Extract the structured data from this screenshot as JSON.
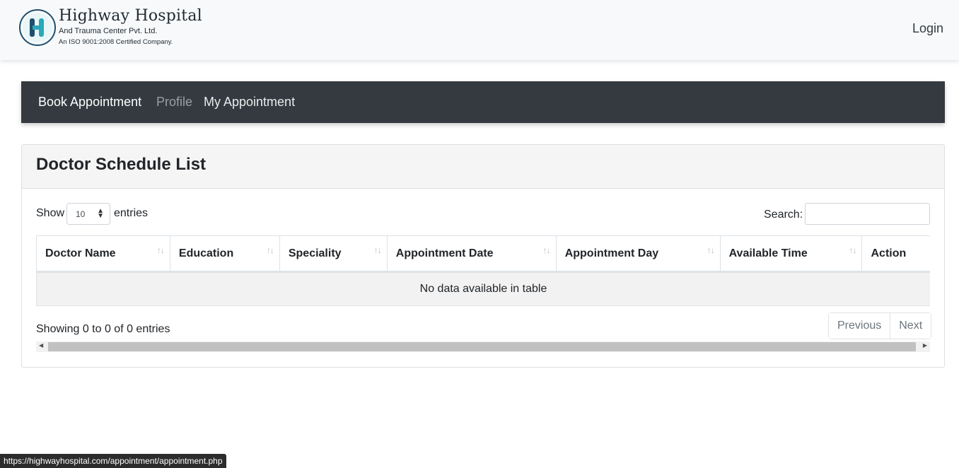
{
  "header": {
    "logo_title": "Highway Hospital",
    "logo_subtitle": "And Trauma Center Pvt. Ltd.",
    "logo_tagline": "An ISO 9001:2008 Certified Company.",
    "login_label": "Login",
    "colors": {
      "logo_teal": "#2aa8b8",
      "logo_dark": "#1f4f6b"
    }
  },
  "nav": {
    "items": [
      {
        "label": "Book Appointment",
        "state": "active"
      },
      {
        "label": "Profile",
        "state": "muted"
      },
      {
        "label": "My Appointment",
        "state": "normal"
      }
    ],
    "background": "#343a40"
  },
  "card": {
    "title": "Doctor Schedule List",
    "show_label": "Show",
    "entries_value": "10",
    "entries_label": "entries",
    "search_label": "Search:",
    "search_value": "",
    "columns": [
      "Doctor Name",
      "Education",
      "Speciality",
      "Appointment Date",
      "Appointment Day",
      "Available Time",
      "Action"
    ],
    "empty_message": "No data available in table",
    "info": "Showing 0 to 0 of 0 entries",
    "pager": {
      "previous": "Previous",
      "next": "Next"
    }
  },
  "status_bar": {
    "url": "https://highwayhospital.com/appointment/appointment.php"
  }
}
